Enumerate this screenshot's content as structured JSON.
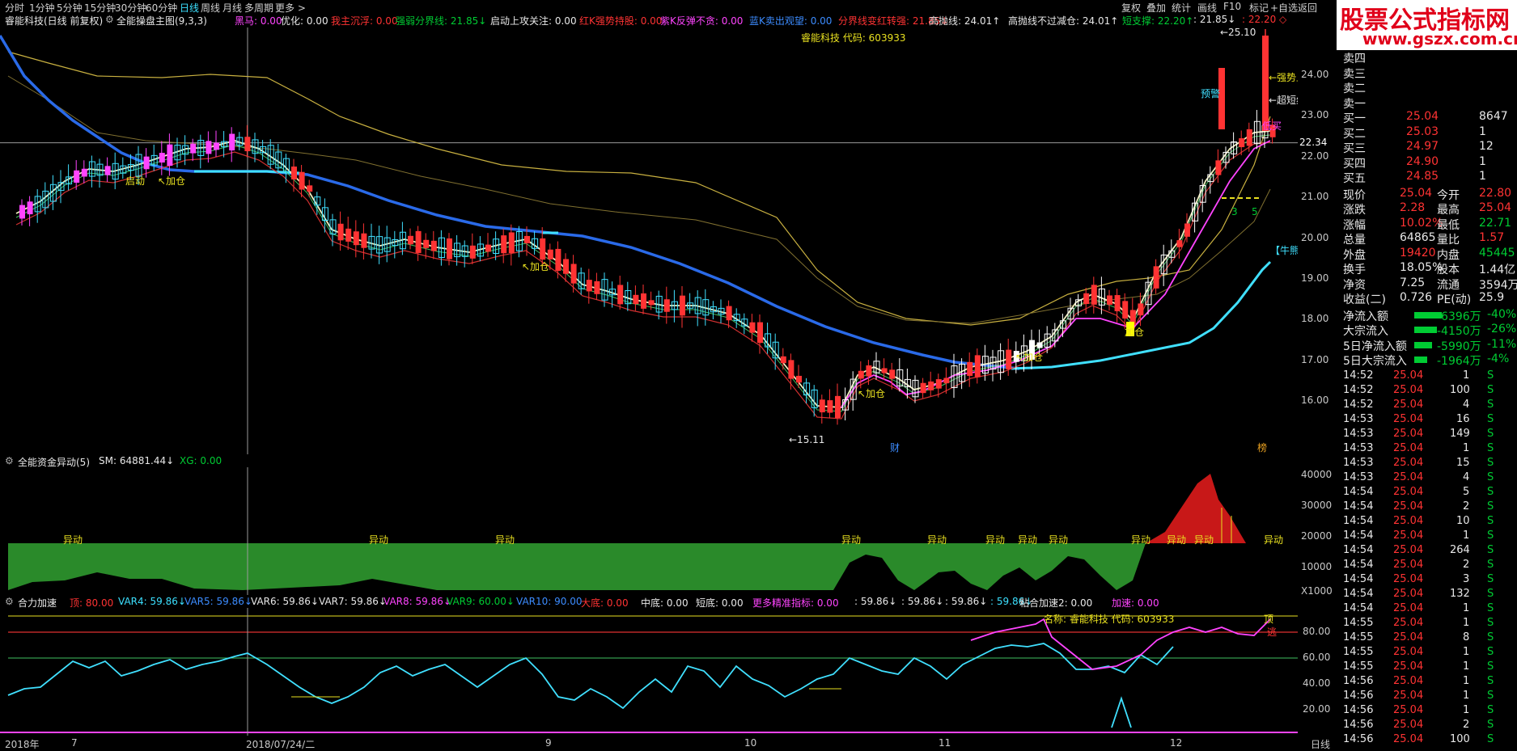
{
  "topbar": {
    "periods": [
      "分时",
      "1分钟",
      "5分钟",
      "15分钟",
      "30分钟",
      "60分钟",
      "日线",
      "周线",
      "月线",
      "多周期",
      "更多 >"
    ],
    "active": "日线",
    "right": [
      "复权",
      "叠加",
      "统计",
      "画线",
      "F10",
      "标记",
      "+自选",
      "返回"
    ]
  },
  "indicator_bar": {
    "stock": "睿能科技(日线 前复权)",
    "formula": "全能操盘主图(9,3,3)",
    "items": [
      {
        "label": "黑马: 0.00",
        "color": "#ff44ff"
      },
      {
        "label": "优化: 0.00",
        "color": "#e8e8e8"
      },
      {
        "label": "我主沉浮: 0.00",
        "color": "#ff3333"
      },
      {
        "label": "强弱分界线: 21.85↓",
        "color": "#00cc33"
      },
      {
        "label": "启动上攻关注: 0.00",
        "color": "#e8e8e8"
      },
      {
        "label": "红K强势持股: 0.00",
        "color": "#ff3333"
      },
      {
        "label": "紫K反弹不贪: 0.00",
        "color": "#ff44ff"
      },
      {
        "label": "蓝K卖出观望: 0.00",
        "color": "#3c8cff"
      },
      {
        "label": "分界线变红转强: 21.85↓",
        "color": "#ff3333"
      },
      {
        "label": "高抛线: 24.01↑",
        "color": "#e8e8e8"
      },
      {
        "label": "高抛线不过减仓: 24.01↑",
        "color": "#e8e8e8"
      },
      {
        "label": "短支撑: 22.20↑",
        "color": "#00cc33"
      },
      {
        "label": ": 21.85↓",
        "color": "#e8e8e8"
      },
      {
        "label": ": 22.20 ◇",
        "color": "#ff3333"
      }
    ]
  },
  "main_chart": {
    "stock_label": "睿能科技 代码: 603933",
    "annotations": {
      "qidong": "启动",
      "jiacang": "加仓",
      "low": "15.11",
      "high": "25.10",
      "qiangshi": "强势上",
      "chaoduan": "超短线",
      "dimai": "低买",
      "yujing": "预警",
      "niuxiong": "牛熊分",
      "cai": "财",
      "top": "榜",
      "nums": [
        "3",
        "5"
      ]
    },
    "price_axis": [
      "24.00",
      "23.00",
      "22.00",
      "21.00",
      "20.00",
      "19.00",
      "18.00",
      "17.00",
      "16.00"
    ],
    "cross_price": "22.34",
    "chart_data": {
      "type": "candlestick",
      "y_range": [
        15.11,
        25.1
      ],
      "ticks": [
        "24.00",
        "23.00",
        "22.00",
        "21.00",
        "20.00",
        "19.00",
        "18.00",
        "17.00",
        "16.00"
      ],
      "marked_low": 15.11,
      "marked_high": 25.1,
      "last_close": 25.04
    }
  },
  "fund_panel": {
    "title": "全能资金异动(5)",
    "sm": "SM: 64881.44↓",
    "xg": "XG: 0.00",
    "yaxis": [
      "40000",
      "30000",
      "20000",
      "10000"
    ],
    "unit": "X1000",
    "label": "异动"
  },
  "force_panel": {
    "title": "合力加速",
    "items": [
      {
        "label": "顶: 80.00",
        "color": "#ff3333"
      },
      {
        "label": "VAR4: 59.86↓",
        "color": "#3ce0ff"
      },
      {
        "label": "VAR5: 59.86↓",
        "color": "#3c8cff"
      },
      {
        "label": "VAR6: 59.86↓",
        "color": "#e8e8e8"
      },
      {
        "label": "VAR7: 59.86↓",
        "color": "#e8e8e8"
      },
      {
        "label": "VAR8: 59.86↓",
        "color": "#ff44ff"
      },
      {
        "label": "VAR9: 60.00↓",
        "color": "#00cc33"
      },
      {
        "label": "VAR10: 90.00",
        "color": "#3c8cff"
      },
      {
        "label": "大底: 0.00",
        "color": "#ff3333"
      },
      {
        "label": "中底: 0.00",
        "color": "#e8e8e8"
      },
      {
        "label": "短底: 0.00",
        "color": "#e8e8e8"
      },
      {
        "label": "更多精准指标: 0.00",
        "color": "#ff44ff"
      },
      {
        "label": ": 59.86↓",
        "color": "#e8e8e8"
      },
      {
        "label": ": 59.86↓",
        "color": "#e8e8e8"
      },
      {
        "label": ": 59.86↓",
        "color": "#e8e8e8"
      },
      {
        "label": ": 59.86↓",
        "color": "#3ce0ff"
      },
      {
        "label": "粘合加速2: 0.00",
        "color": "#e8e8e8"
      },
      {
        "label": "加速: 0.00",
        "color": "#ff44ff"
      }
    ],
    "name_label": "名称: 睿能科技 代码: 603933",
    "top_label": "顶",
    "escape_label": "逃",
    "yaxis": [
      "80.00",
      "60.00",
      "40.00",
      "20.00"
    ]
  },
  "date_axis": [
    "2018年",
    "7",
    "2018/07/24/二",
    "9",
    "10",
    "11",
    "12",
    "日线"
  ],
  "logo": {
    "title": "股票公式指标网",
    "url": "www.gszx.com.cn"
  },
  "orderbook": {
    "sell": [
      {
        "name": "卖四",
        "price": "",
        "vol": ""
      },
      {
        "name": "卖三",
        "price": "",
        "vol": ""
      },
      {
        "name": "卖二",
        "price": "",
        "vol": ""
      },
      {
        "name": "卖一",
        "price": "",
        "vol": ""
      }
    ],
    "buy": [
      {
        "name": "买一",
        "price": "25.04",
        "vol": "8647"
      },
      {
        "name": "买二",
        "price": "25.03",
        "vol": "1"
      },
      {
        "name": "买三",
        "price": "24.97",
        "vol": "12"
      },
      {
        "name": "买四",
        "price": "24.90",
        "vol": "1"
      },
      {
        "name": "买五",
        "price": "24.85",
        "vol": "1"
      }
    ]
  },
  "stats": [
    {
      "k1": "现价",
      "v1": "25.04",
      "c1": "red",
      "k2": "今开",
      "v2": "22.80",
      "c2": "red"
    },
    {
      "k1": "涨跌",
      "v1": "2.28",
      "c1": "red",
      "k2": "最高",
      "v2": "25.04",
      "c2": "red"
    },
    {
      "k1": "涨幅",
      "v1": "10.02%",
      "c1": "red",
      "k2": "最低",
      "v2": "22.71",
      "c2": "green"
    },
    {
      "k1": "总量",
      "v1": "64865",
      "c1": "white",
      "k2": "量比",
      "v2": "1.57",
      "c2": "red"
    },
    {
      "k1": "外盘",
      "v1": "19420",
      "c1": "red",
      "k2": "内盘",
      "v2": "45445",
      "c2": "green"
    },
    {
      "k1": "换手",
      "v1": "18.05%",
      "c1": "white",
      "k2": "股本",
      "v2": "1.44亿",
      "c2": "white"
    },
    {
      "k1": "净资",
      "v1": "7.25",
      "c1": "white",
      "k2": "流通",
      "v2": "3594万",
      "c2": "white"
    },
    {
      "k1": "收益(二)",
      "v1": "0.726",
      "c1": "white",
      "k2": "PE(动)",
      "v2": "25.9",
      "c2": "white"
    }
  ],
  "flows": [
    {
      "k": "净流入额",
      "v": "-6396万",
      "p": "-40%"
    },
    {
      "k": "大宗流入",
      "v": "-4150万",
      "p": "-26%"
    },
    {
      "k": "5日净流入额",
      "v": "-5990万",
      "p": "-11%"
    },
    {
      "k": "5日大宗流入",
      "v": "-1964万",
      "p": "-4%"
    }
  ],
  "trades": [
    {
      "t": "14:52",
      "p": "25.04",
      "v": "1",
      "s": "S"
    },
    {
      "t": "14:52",
      "p": "25.04",
      "v": "100",
      "s": "S"
    },
    {
      "t": "14:52",
      "p": "25.04",
      "v": "4",
      "s": "S"
    },
    {
      "t": "14:53",
      "p": "25.04",
      "v": "16",
      "s": "S"
    },
    {
      "t": "14:53",
      "p": "25.04",
      "v": "149",
      "s": "S"
    },
    {
      "t": "14:53",
      "p": "25.04",
      "v": "1",
      "s": "S"
    },
    {
      "t": "14:53",
      "p": "25.04",
      "v": "15",
      "s": "S"
    },
    {
      "t": "14:53",
      "p": "25.04",
      "v": "4",
      "s": "S"
    },
    {
      "t": "14:54",
      "p": "25.04",
      "v": "5",
      "s": "S"
    },
    {
      "t": "14:54",
      "p": "25.04",
      "v": "2",
      "s": "S"
    },
    {
      "t": "14:54",
      "p": "25.04",
      "v": "10",
      "s": "S"
    },
    {
      "t": "14:54",
      "p": "25.04",
      "v": "1",
      "s": "S"
    },
    {
      "t": "14:54",
      "p": "25.04",
      "v": "264",
      "s": "S"
    },
    {
      "t": "14:54",
      "p": "25.04",
      "v": "2",
      "s": "S"
    },
    {
      "t": "14:54",
      "p": "25.04",
      "v": "3",
      "s": "S"
    },
    {
      "t": "14:54",
      "p": "25.04",
      "v": "132",
      "s": "S"
    },
    {
      "t": "14:54",
      "p": "25.04",
      "v": "1",
      "s": "S"
    },
    {
      "t": "14:55",
      "p": "25.04",
      "v": "1",
      "s": "S"
    },
    {
      "t": "14:55",
      "p": "25.04",
      "v": "8",
      "s": "S"
    },
    {
      "t": "14:55",
      "p": "25.04",
      "v": "1",
      "s": "S"
    },
    {
      "t": "14:55",
      "p": "25.04",
      "v": "1",
      "s": "S"
    },
    {
      "t": "14:56",
      "p": "25.04",
      "v": "1",
      "s": "S"
    },
    {
      "t": "14:56",
      "p": "25.04",
      "v": "1",
      "s": "S"
    },
    {
      "t": "14:56",
      "p": "25.04",
      "v": "1",
      "s": "S"
    },
    {
      "t": "14:56",
      "p": "25.04",
      "v": "2",
      "s": "S"
    },
    {
      "t": "14:56",
      "p": "25.04",
      "v": "100",
      "s": "S"
    }
  ]
}
